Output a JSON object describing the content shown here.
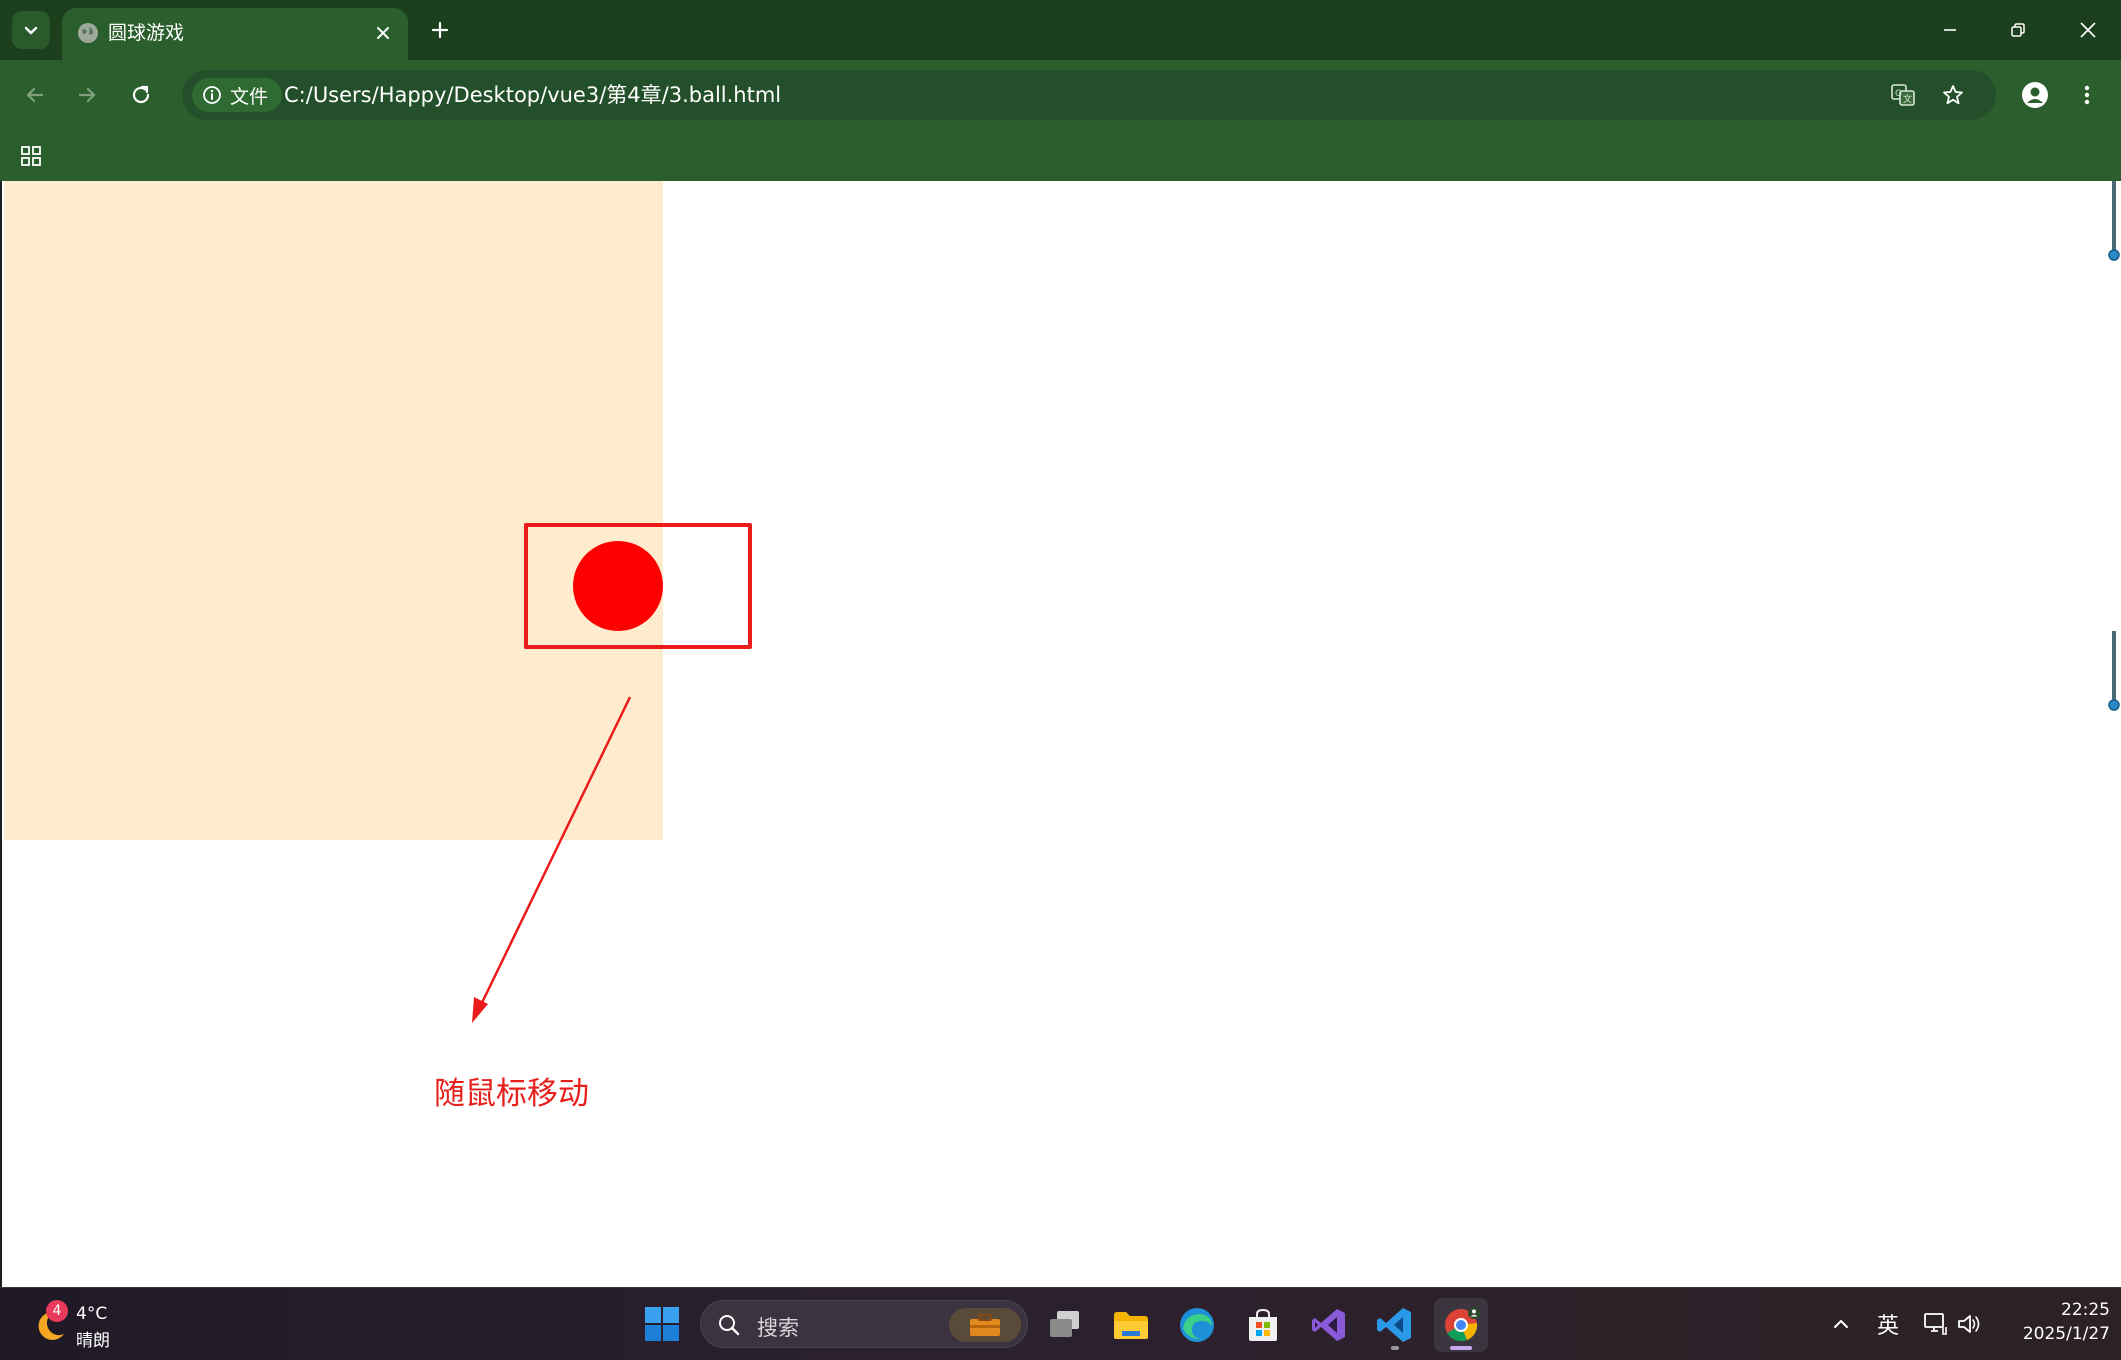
{
  "browser": {
    "tab_title": "圆球游戏",
    "chip_label": "文件",
    "url": "C:/Users/Happy/Desktop/vue3/第4章/3.ball.html",
    "theme_color": "#2b5e2d"
  },
  "page": {
    "play_area_color": "#ffecce",
    "ball_color": "#ff0000",
    "annotation_text": "随鼠标移动",
    "annotation_color": "#e8201c"
  },
  "taskbar": {
    "weather_badge": "4",
    "weather_temp": "4°C",
    "weather_desc": "晴朗",
    "search_placeholder": "搜索",
    "input_lang": "英",
    "clock_time": "22:25",
    "clock_date": "2025/1/27"
  }
}
